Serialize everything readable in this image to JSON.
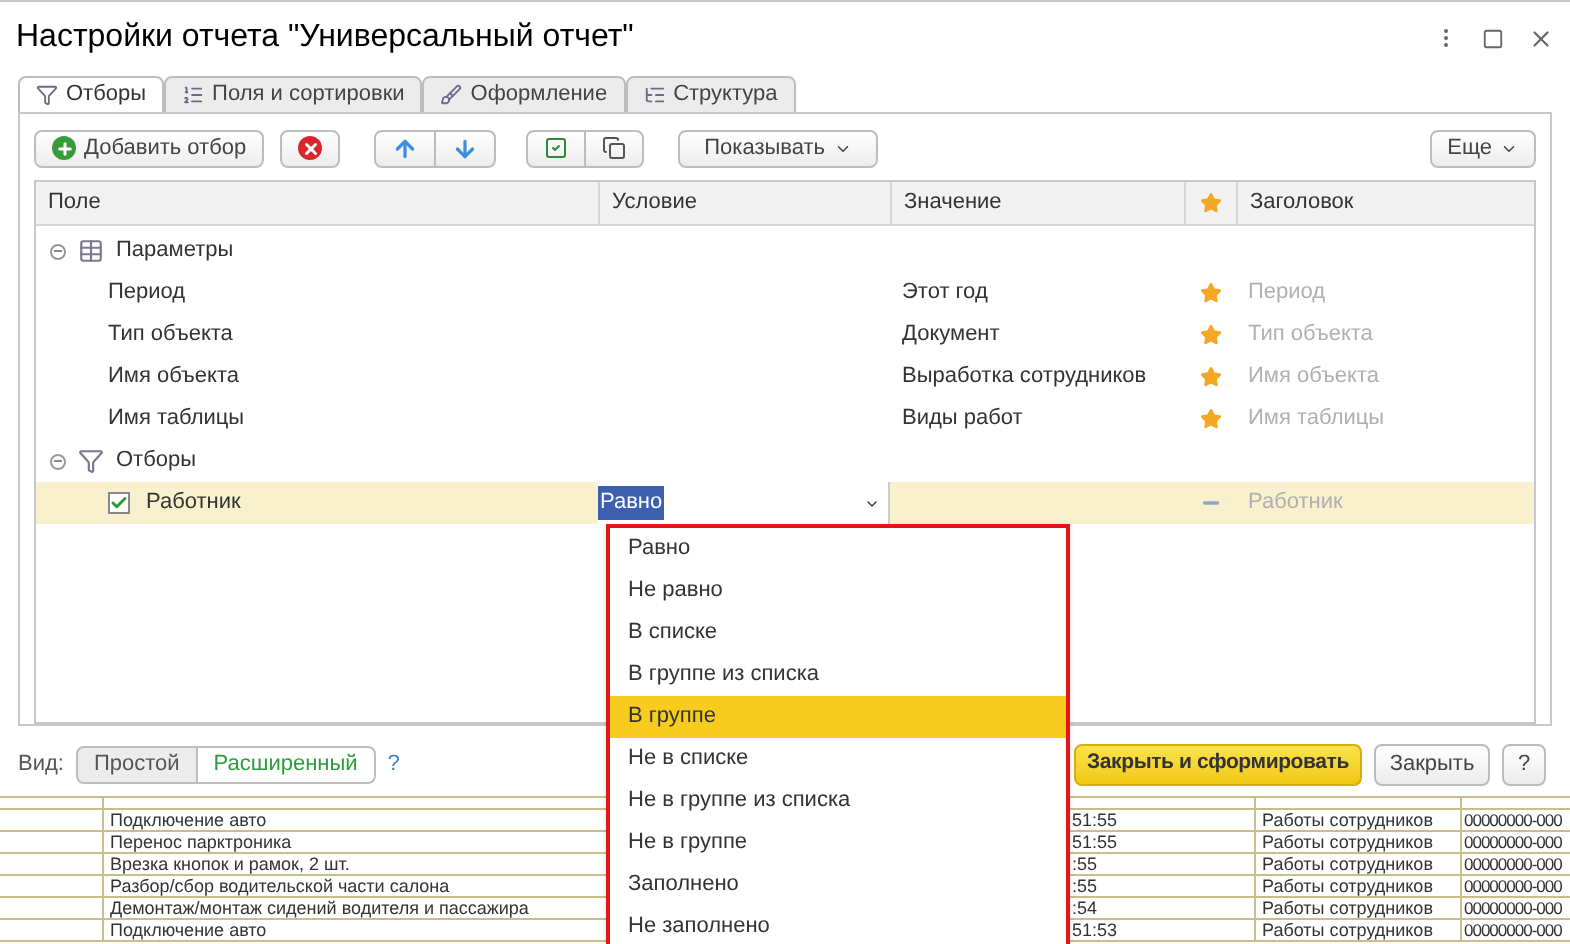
{
  "window": {
    "title": "Настройки отчета \"Универсальный отчет\""
  },
  "tabs": [
    {
      "label": "Отборы",
      "selected": true,
      "kind": "filter"
    },
    {
      "label": "Поля и сортировки",
      "selected": false,
      "kind": "fields"
    },
    {
      "label": "Оформление",
      "selected": false,
      "kind": "brush"
    },
    {
      "label": "Структура",
      "selected": false,
      "kind": "structure"
    }
  ],
  "toolbar": {
    "add_button": "Добавить отбор",
    "show_menu": "Показывать",
    "more_menu": "Еще"
  },
  "table": {
    "columns": [
      "Поле",
      "Условие",
      "Значение",
      "Заголовок"
    ],
    "rows": [
      {
        "field": "Параметры",
        "expanded": true,
        "kind": "params",
        "children": [
          {
            "field": "Период",
            "value": "Этот год",
            "title": "Период",
            "starred": true,
            "selected": false
          },
          {
            "field": "Тип объекта",
            "value": "Документ",
            "title": "Тип объекта",
            "starred": true,
            "selected": false
          },
          {
            "field": "Имя объекта",
            "value": "Выработка сотрудников",
            "title": "Имя объекта",
            "starred": true,
            "selected": false
          },
          {
            "field": "Имя таблицы",
            "value": "Виды работ",
            "title": "Имя таблицы",
            "starred": true,
            "selected": false
          }
        ]
      },
      {
        "field": "Отборы",
        "expanded": true,
        "kind": "filters",
        "children": [
          {
            "field": "Работник",
            "checked": true,
            "condition": "Равно",
            "title": "Работник",
            "starred": false,
            "selected": true
          }
        ]
      }
    ]
  },
  "condition_dropdown": {
    "options": [
      {
        "label": "Равно",
        "selected": false
      },
      {
        "label": "Не равно",
        "selected": false
      },
      {
        "label": "В списке",
        "selected": false
      },
      {
        "label": "В группе из списка",
        "selected": false
      },
      {
        "label": "В группе",
        "selected": true
      },
      {
        "label": "Не в списке",
        "selected": false
      },
      {
        "label": "Не в группе из списка",
        "selected": false
      },
      {
        "label": "Не в группе",
        "selected": false
      },
      {
        "label": "Заполнено",
        "selected": false
      },
      {
        "label": "Не заполнено",
        "selected": false
      }
    ]
  },
  "footer": {
    "view_label": "Вид:",
    "view_modes": [
      {
        "label": "Простой",
        "selected": false
      },
      {
        "label": "Расширенный",
        "selected": true
      }
    ],
    "help_link": "?",
    "buttons": [
      {
        "label": "Закрыть и сформировать",
        "kind": "primary"
      },
      {
        "label": "Закрыть",
        "kind": "normal"
      },
      {
        "label": "?",
        "kind": "normal"
      }
    ]
  },
  "report_rows": [
    {
      "column_2": "Подключение авто",
      "column_3": "51:55",
      "column_4": "Работы сотрудников",
      "column_5": "00000000-000"
    },
    {
      "column_2": "Перенос парктроника",
      "column_3": "51:55",
      "column_4": "Работы сотрудников",
      "column_5": "00000000-000"
    },
    {
      "column_2": "Врезка кнопок и рамок, 2 шт.",
      "column_3": ":55",
      "column_4": "Работы сотрудников",
      "column_5": "00000000-000"
    },
    {
      "column_2": "Разбор/сбор водительской части салона",
      "column_3": ":55",
      "column_4": "Работы сотрудников",
      "column_5": "00000000-000"
    },
    {
      "column_2": "Демонтаж/монтаж сидений водителя и пассажира",
      "column_3": ":54",
      "column_4": "Работы сотрудников",
      "column_5": "00000000-000"
    },
    {
      "column_2": "Подключение авто",
      "column_3": "51:53",
      "column_4": "Работы сотрудников",
      "column_5": "00000000-000"
    }
  ]
}
